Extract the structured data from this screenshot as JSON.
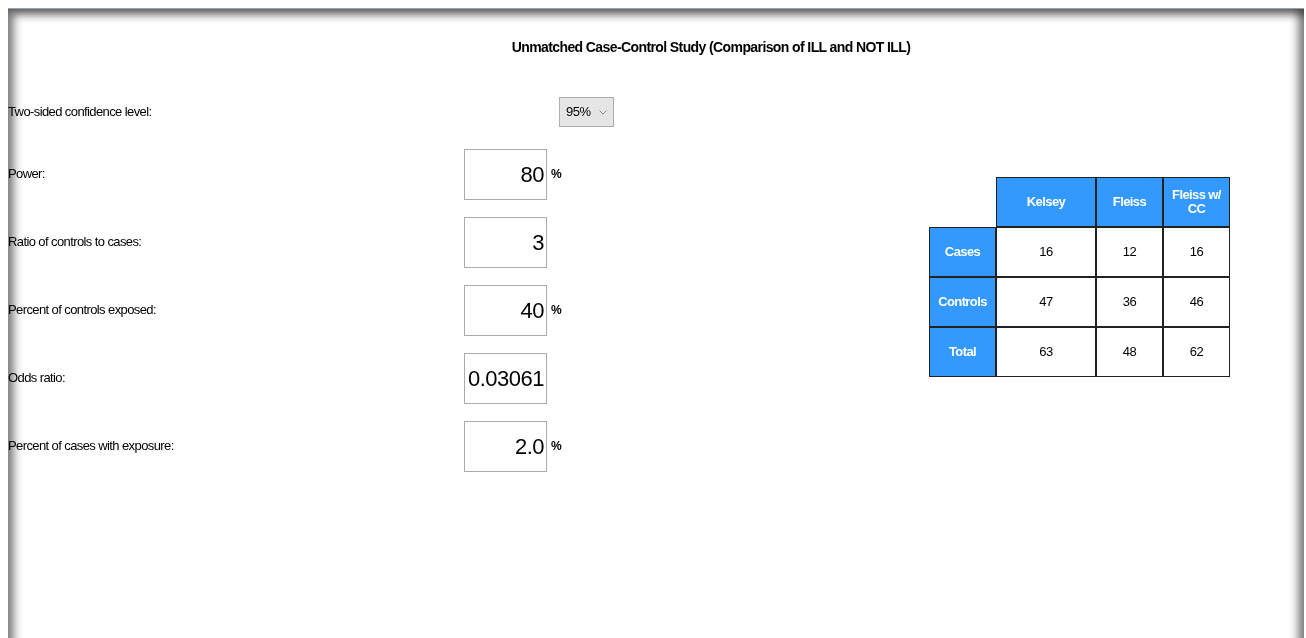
{
  "title": "Unmatched Case-Control Study (Comparison of ILL and NOT ILL)",
  "confidence": {
    "label": "Two-sided confidence level:",
    "value": "95%"
  },
  "fields": [
    {
      "label": "Power:",
      "value": "80",
      "unit": "%"
    },
    {
      "label": "Ratio of controls to cases:",
      "value": "3"
    },
    {
      "label": "Percent of controls exposed:",
      "value": "40",
      "unit": "%"
    },
    {
      "label": "Odds ratio:",
      "value": "0.03061"
    },
    {
      "label": "Percent of cases with exposure:",
      "value": "2.0",
      "unit": "%"
    }
  ],
  "table": {
    "columns": [
      "Kelsey",
      "Fleiss",
      "Fleiss w/ CC"
    ],
    "rows": [
      {
        "label": "Cases",
        "values": [
          "16",
          "12",
          "16"
        ]
      },
      {
        "label": "Controls",
        "values": [
          "47",
          "36",
          "46"
        ]
      },
      {
        "label": "Total",
        "values": [
          "63",
          "48",
          "62"
        ]
      }
    ]
  }
}
